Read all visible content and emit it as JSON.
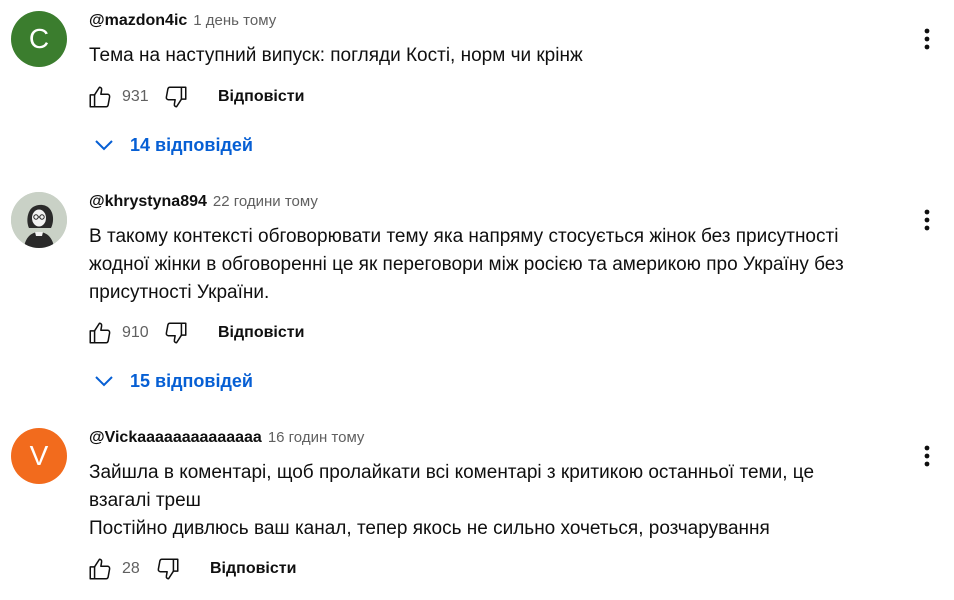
{
  "icons": {
    "like": "thumb-up-icon",
    "dislike": "thumb-down-icon",
    "more": "more-vert-icon",
    "expand": "chevron-down-icon"
  },
  "colors": {
    "link_blue": "#065fd4",
    "avatar_1": "#3b7d2e",
    "avatar_3": "#f26b1d"
  },
  "comments": [
    {
      "avatar_letter": "C",
      "author": "@mazdon4ic",
      "time": "1 день тому",
      "lines": [
        "Тема на наступний випуск: погляди Кості, норм чи крінж"
      ],
      "likes": "931",
      "reply_label": "Відповісти",
      "replies_label": "14 відповідей"
    },
    {
      "avatar_letter": "",
      "author": "@khrystyna894",
      "time": "22 години тому",
      "lines": [
        "В такому контексті обговорювати тему яка напряму стосується жінок без присутності",
        "жодної жінки в обговоренні це як переговори між росією та америкою про Україну без",
        "присутності України."
      ],
      "likes": "910",
      "reply_label": "Відповісти",
      "replies_label": "15 відповідей"
    },
    {
      "avatar_letter": "V",
      "author": "@Vickaaaaaaaaaaaaaa",
      "time": "16 годин тому",
      "lines": [
        "Зайшла в коментарі, щоб пролайкати всі коментарі з критикою останньої теми, це",
        "взагалі треш",
        "Постійно дивлюсь ваш канал, тепер якось не сильно хочеться, розчарування"
      ],
      "likes": "28",
      "reply_label": "Відповісти"
    }
  ]
}
